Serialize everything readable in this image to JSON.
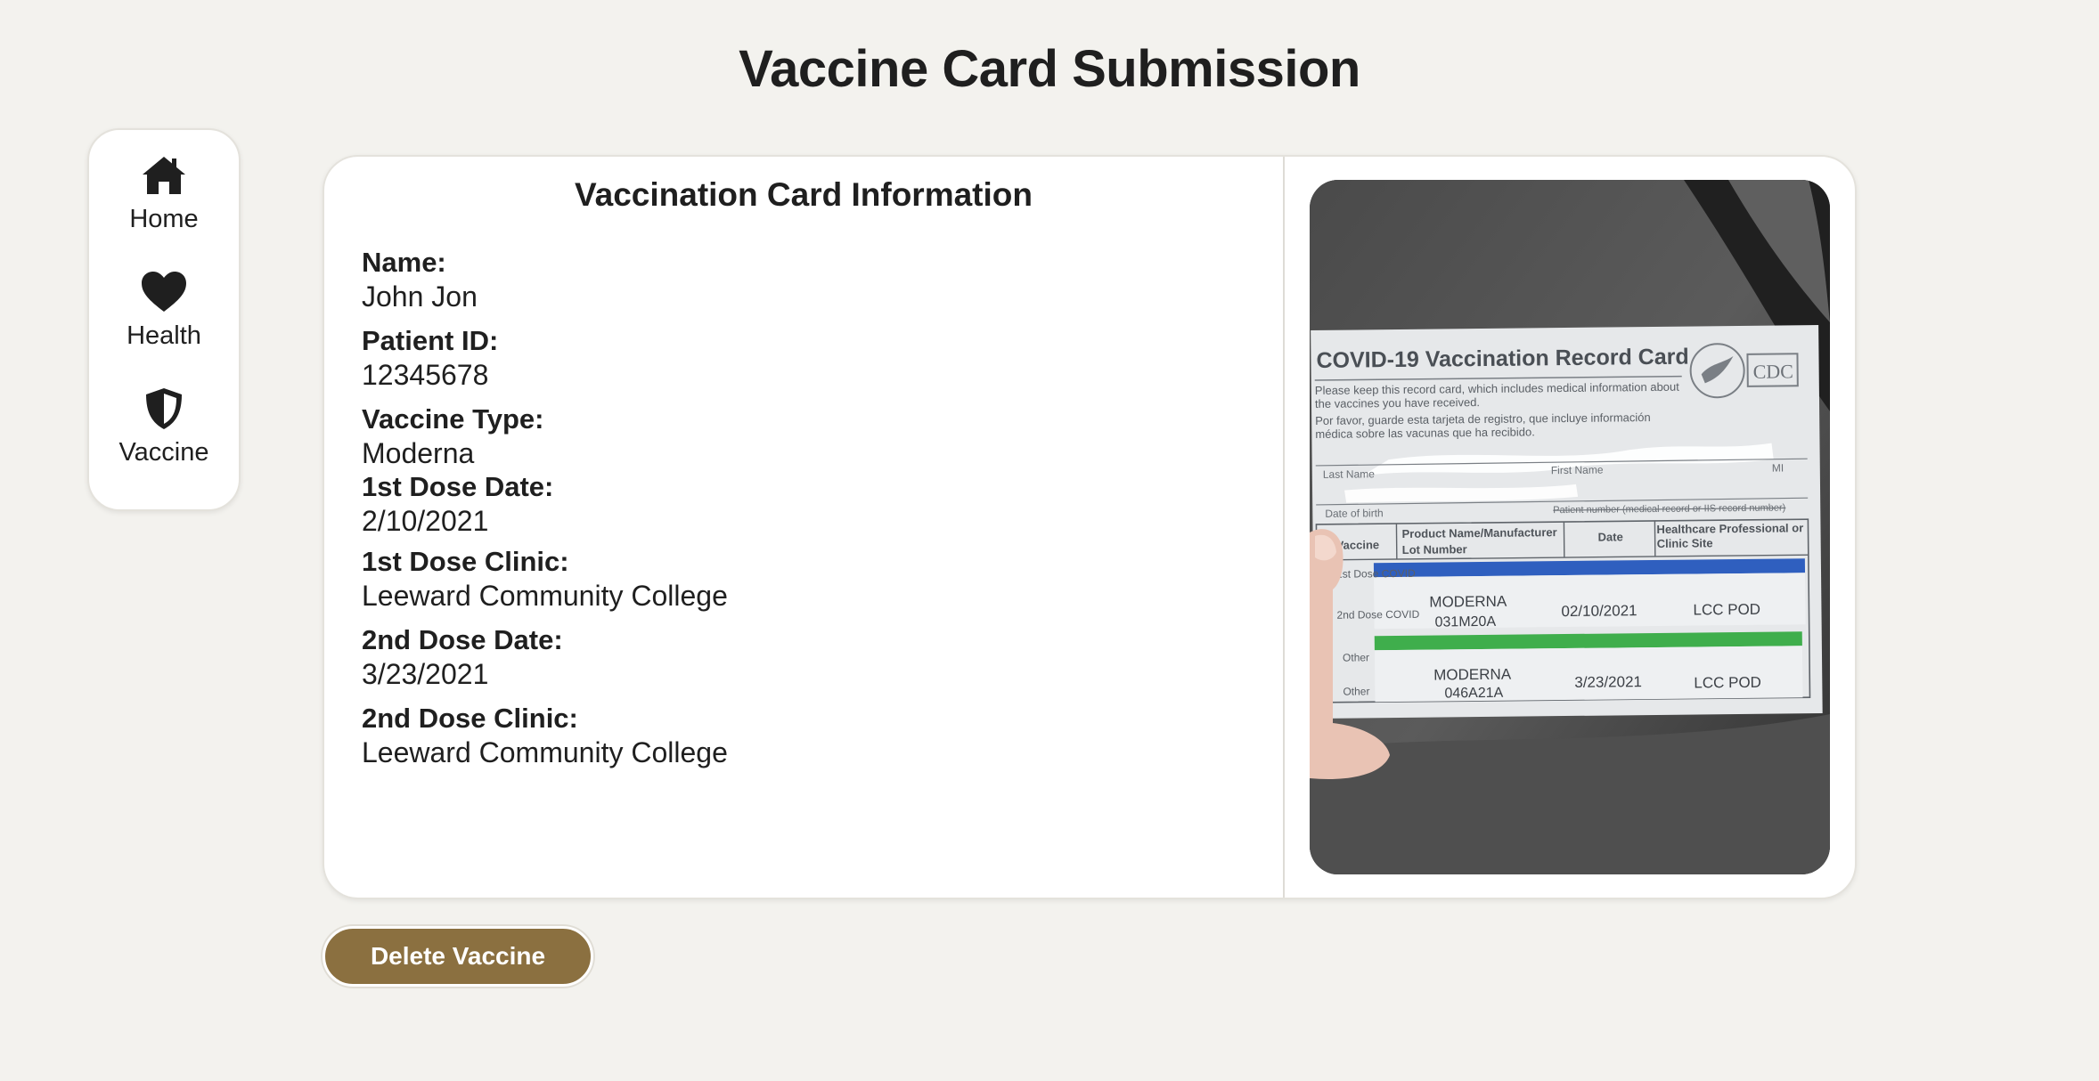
{
  "page": {
    "title": "Vaccine Card Submission"
  },
  "sidebar": {
    "items": [
      {
        "label": "Home",
        "icon": "home-icon"
      },
      {
        "label": "Health",
        "icon": "heart-icon"
      },
      {
        "label": "Vaccine",
        "icon": "shield-icon"
      }
    ]
  },
  "card_info": {
    "title": "Vaccination Card Information",
    "fields": [
      {
        "label": "Name:",
        "value": "John Jon"
      },
      {
        "label": "Patient ID:",
        "value": "12345678"
      },
      {
        "label": "Vaccine Type:",
        "value": "Moderna"
      },
      {
        "label": "1st Dose Date:",
        "value": "2/10/2021"
      },
      {
        "label": "1st Dose Clinic:",
        "value": "Leeward Community College"
      },
      {
        "label": "2nd Dose Date:",
        "value": "3/23/2021"
      },
      {
        "label": "2nd Dose Clinic:",
        "value": "Leeward Community College"
      }
    ]
  },
  "photo": {
    "card_title": "COVID-19 Vaccination Record Card",
    "card_intro_en": "Please keep this record card, which includes medical information about the vaccines you have received.",
    "card_intro_es": "Por favor, guarde esta tarjeta de registro, que incluye información médica sobre las vacunas que ha recibido.",
    "cdc_logo": "CDC",
    "col_last_name": "Last Name",
    "col_first_name": "First Name",
    "col_mi": "MI",
    "col_dob": "Date of birth",
    "col_patient_number": "Patient number (medical record or IIS record number)",
    "col_vaccine": "Vaccine",
    "col_product": "Product Name/Manufacturer",
    "col_lot": "Lot Number",
    "col_date": "Date",
    "col_site": "Healthcare Professional or Clinic Site",
    "dose1_product": "MODERNA",
    "dose1_lot": "031M20A",
    "dose1_date": "02/10/2021",
    "dose1_site": "LCC POD",
    "dose2_product": "MODERNA",
    "dose2_lot": "046A21A",
    "dose2_date": "3/23/2021",
    "dose2_site": "LCC POD",
    "row_dose1": "1st Dose COVID",
    "row_dose2": "2nd Dose COVID",
    "row_other": "Other"
  },
  "actions": {
    "delete_label": "Delete Vaccine"
  }
}
